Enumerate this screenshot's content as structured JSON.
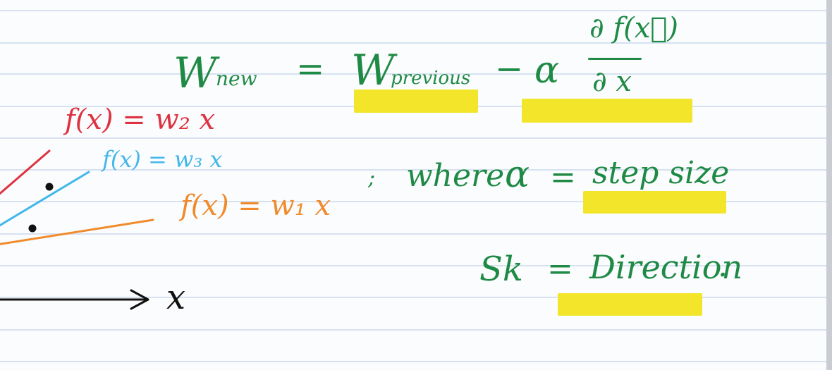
{
  "equation": {
    "w_new_base": "W",
    "w_new_sub": "new",
    "equals": "=",
    "w_prev_base": "W",
    "w_prev_sub": "previous",
    "minus": "−",
    "alpha": "α",
    "numerator": "∂ f(x⃗)",
    "denominator": "∂ x"
  },
  "note_alpha": {
    "prefix": ";",
    "where": "where",
    "alpha": "α",
    "equals": "=",
    "meaning": "step size"
  },
  "note_sk": {
    "symbol": "Sk",
    "equals": "=",
    "meaning": "Direction",
    "period": "."
  },
  "graph": {
    "line_red_label": "f(x) = w₂ x",
    "line_blue_label": "f(x) = w₃ x",
    "line_orange_label": "f(x) = w₁ x",
    "x_axis_label": "x"
  },
  "colors": {
    "green_ink": "#1f8a45",
    "red_ink": "#dd3340",
    "blue_ink": "#42b7ea",
    "orange_ink": "#f08a2b",
    "highlight": "#f3e52a"
  }
}
